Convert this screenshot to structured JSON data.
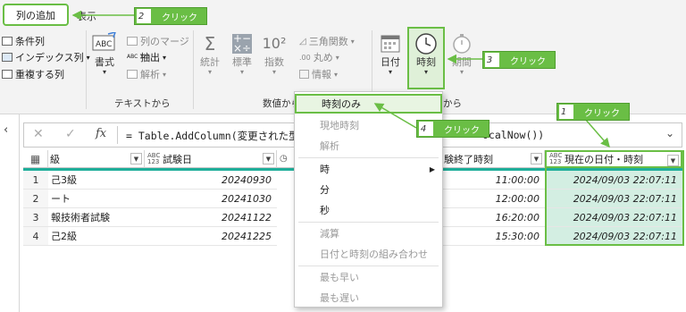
{
  "ribbon": {
    "tabs": [
      "列の追加",
      "表示"
    ],
    "general_items": [
      "条件列",
      "インデックス列",
      "重複する列"
    ],
    "text_group": {
      "format_label": "書式",
      "items": [
        "列のマージ",
        "抽出",
        "解析"
      ],
      "group_label": "テキストから"
    },
    "number_group": {
      "buttons": [
        "統計",
        "標準",
        "指数"
      ],
      "items": [
        "三角関数",
        "丸め",
        "情報"
      ],
      "group_label": "数値から"
    },
    "datetime_group": {
      "buttons": [
        "日付",
        "時刻",
        "期間"
      ],
      "group_label_partial": "から"
    }
  },
  "formula": {
    "fx": "fx",
    "text_left": "= Table.AddColumn(変更された型,",
    "text_right": "ocalNow())"
  },
  "table": {
    "headers": [
      {
        "type": "",
        "label": "級"
      },
      {
        "type": "ABC 123",
        "label": "試験日"
      },
      {
        "type": "",
        "label": ""
      },
      {
        "type": "",
        "label": "験終了時刻"
      },
      {
        "type": "ABC 123",
        "label": "現在の日付・時刻"
      }
    ],
    "rows": [
      {
        "n": "1",
        "name": "己3級",
        "date": "20240930",
        "end": "11:00:00",
        "now": "2024/09/03 22:07:11"
      },
      {
        "n": "2",
        "name": "ート",
        "date": "20241030",
        "end": "12:00:00",
        "now": "2024/09/03 22:07:11"
      },
      {
        "n": "3",
        "name": "報技術者試験",
        "date": "20241122",
        "end": "16:20:00",
        "now": "2024/09/03 22:07:11"
      },
      {
        "n": "4",
        "name": "己2級",
        "date": "20241225",
        "end": "15:30:00",
        "now": "2024/09/03 22:07:11"
      }
    ]
  },
  "menu": {
    "items": [
      "時刻のみ",
      "現地時刻",
      "解析",
      "時",
      "分",
      "秒",
      "減算",
      "日付と時刻の組み合わせ",
      "最も早い",
      "最も遅い"
    ]
  },
  "callouts": [
    {
      "num": "1",
      "text": "クリック"
    },
    {
      "num": "2",
      "text": "クリック"
    },
    {
      "num": "3",
      "text": "クリック"
    },
    {
      "num": "4",
      "text": "クリック"
    }
  ],
  "colors": {
    "accent": "#6abe45",
    "teal": "#1fae9a",
    "time_btn_bg": "#dff0d8"
  }
}
